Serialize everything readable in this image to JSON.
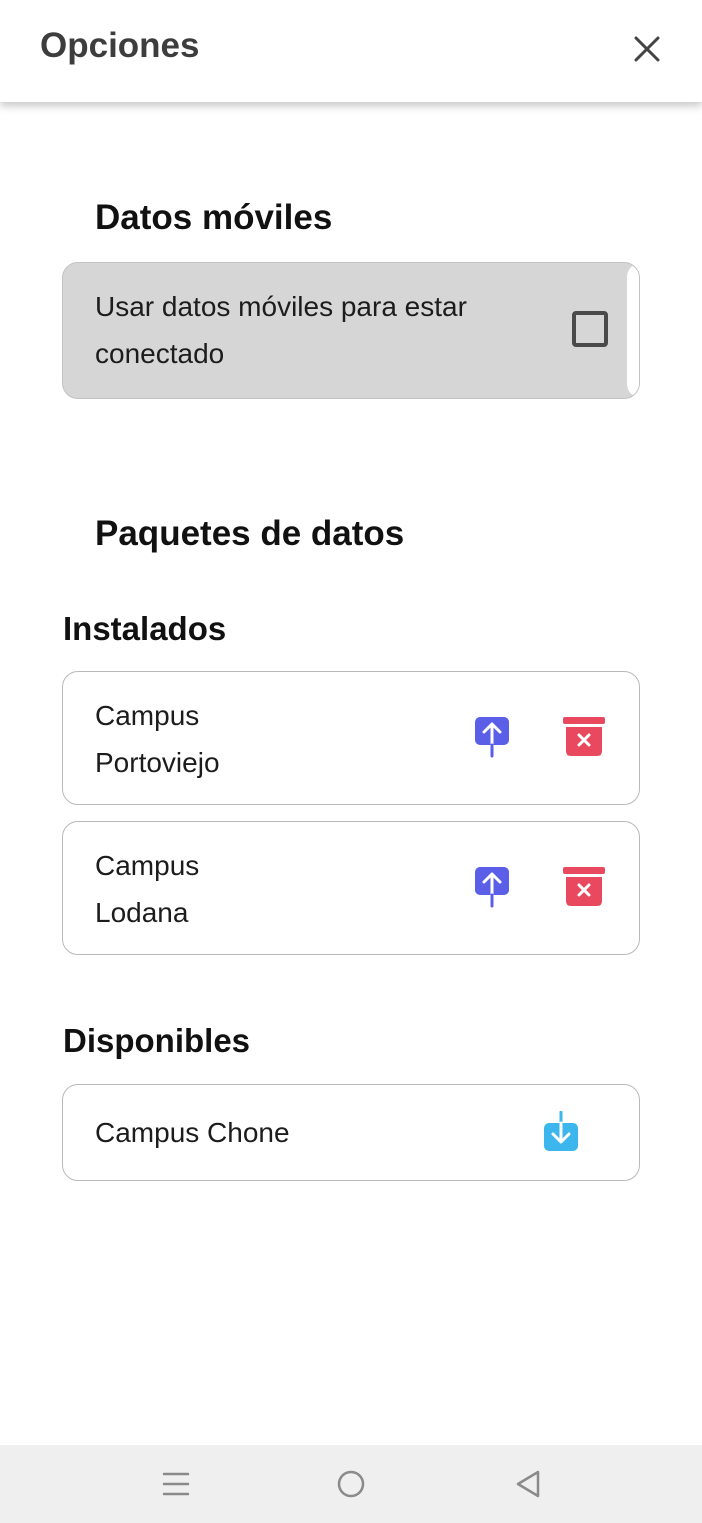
{
  "header": {
    "title": "Opciones",
    "close_icon": "close-icon"
  },
  "mobile_data": {
    "section_title": "Datos móviles",
    "option_label": "Usar datos móviles para estar conectado",
    "checked": false
  },
  "packages": {
    "section_title": "Paquetes de datos",
    "installed": {
      "title": "Instalados",
      "items": [
        {
          "name_line1": "Campus",
          "name_line2": "Portoviejo",
          "update_icon": "upload-icon",
          "delete_icon": "trash-icon"
        },
        {
          "name_line1": "Campus",
          "name_line2": "Lodana",
          "update_icon": "upload-icon",
          "delete_icon": "trash-icon"
        }
      ]
    },
    "available": {
      "title": "Disponibles",
      "items": [
        {
          "name": "Campus Chone",
          "download_icon": "download-icon"
        }
      ]
    }
  },
  "colors": {
    "upload_icon": "#5b5fe8",
    "delete_icon": "#e8495e",
    "download_icon": "#3db6ee",
    "mobile_card_bg": "#d6d6d6"
  },
  "navbar": {
    "icons": [
      "menu-icon",
      "home-icon",
      "back-icon"
    ]
  }
}
